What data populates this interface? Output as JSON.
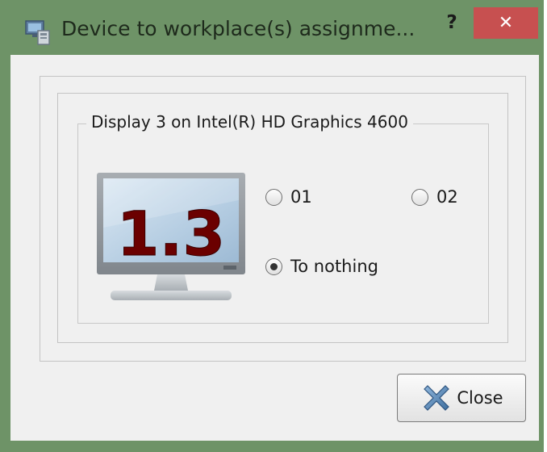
{
  "window": {
    "title": "Device to workplace(s) assignme...",
    "help_label": "?",
    "close_label": "✕"
  },
  "group": {
    "title": "Display 3 on Intel(R) HD Graphics 4600"
  },
  "monitor": {
    "number": "1.3",
    "number_color": "#6b0000"
  },
  "radios": [
    {
      "label": "01",
      "checked": false
    },
    {
      "label": "02",
      "checked": false
    },
    {
      "label": "To nothing",
      "checked": true
    }
  ],
  "close_button": {
    "label": "Close",
    "icon": "close-x-icon"
  },
  "colors": {
    "title_bar": "#6e9367",
    "close_red": "#c75050",
    "panel_bg": "#f0f0f0"
  }
}
